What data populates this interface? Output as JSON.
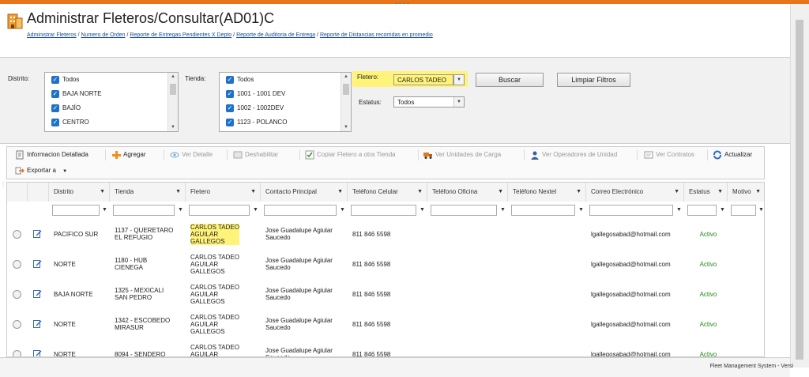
{
  "header": {
    "title": "Administrar Fleteros/Consultar(AD01)C",
    "breadcrumb": [
      {
        "label": "Administrar Fleteros"
      },
      {
        "label": "Numero de Orden"
      },
      {
        "label": "Reporte de Entregas Pendientes X Depto"
      },
      {
        "label": "Reporte de Auditoria de Entrega"
      },
      {
        "label": "Reporte de Distancias recorridas en promedio"
      }
    ],
    "separator": "/"
  },
  "filters": {
    "distrito_label": "Distrito:",
    "distrito_items": [
      "Todos",
      "BAJA NORTE",
      "BAJÍO",
      "CENTRO"
    ],
    "tienda_label": "Tienda:",
    "tienda_items": [
      "Todos",
      "1001 - 1001 DEV",
      "1002 - 1002DEV",
      "1123 - POLANCO"
    ],
    "fletero_label": "Fletero:",
    "fletero_value": "CARLOS TADEO",
    "estatus_label": "Estatus:",
    "estatus_value": "Todos",
    "buscar_label": "Buscar",
    "limpiar_label": "Limpiar Filtros"
  },
  "toolbar": {
    "info": "Informacion Detallada",
    "agregar": "Agregar",
    "ver_detalle": "Ver Detalle",
    "deshabilitar": "Deshabilitar",
    "copiar": "Copiar Fletero a otra Tienda",
    "ver_unidades": "Ver Unidades de Carga",
    "ver_operadores": "Ver Operadores de Unidad",
    "ver_contratos": "Ver Contratos",
    "actualizar": "Actualizar",
    "exportar": "Exportar a"
  },
  "grid": {
    "columns": [
      "Distrito",
      "Tienda",
      "Fletero",
      "Contacto Principal",
      "Teléfono Celular",
      "Teléfono Oficina",
      "Teléfono Nextel",
      "Correo Electrónico",
      "Estatus",
      "Motivo"
    ],
    "rows": [
      {
        "distrito": "PACIFICO SUR",
        "tienda": "1137 - QUERETARO\nEL REFUGIO",
        "fletero": "CARLOS TADEO\nAGUILAR\nGALLEGOS",
        "contacto": "Jose Guadalupe Agiular\nSaucedo",
        "celular": "811 846 5598",
        "oficina": "",
        "nextel": "",
        "correo": "lgallegosabad@hotmail.com",
        "estatus": "Activo",
        "motivo": ""
      },
      {
        "distrito": "NORTE",
        "tienda": "1180 - HUB\nCIENEGA",
        "fletero": "CARLOS TADEO\nAGUILAR\nGALLEGOS",
        "contacto": "Jose Guadalupe Agiular\nSaucedo",
        "celular": "811 846 5598",
        "oficina": "",
        "nextel": "",
        "correo": "lgallegosabad@hotmail.com",
        "estatus": "Activo",
        "motivo": ""
      },
      {
        "distrito": "BAJA NORTE",
        "tienda": "1325 - MEXICALI\nSAN PEDRO",
        "fletero": "CARLOS TADEO\nAGUILAR\nGALLEGOS",
        "contacto": "Jose Guadalupe Agiular\nSaucedo",
        "celular": "811 846 5598",
        "oficina": "",
        "nextel": "",
        "correo": "lgallegosabad@hotmail.com",
        "estatus": "Activo",
        "motivo": ""
      },
      {
        "distrito": "NORTE",
        "tienda": "1342 - ESCOBEDO\nMIRASUR",
        "fletero": "CARLOS TADEO\nAGUILAR\nGALLEGOS",
        "contacto": "Jose Guadalupe Agiular\nSaucedo",
        "celular": "811 846 5598",
        "oficina": "",
        "nextel": "",
        "correo": "lgallegosabad@hotmail.com",
        "estatus": "Activo",
        "motivo": ""
      },
      {
        "distrito": "NORTE",
        "tienda": "8094 - SENDERO",
        "fletero": "CARLOS TADEO\nAGUILAR\nGALLEGOS",
        "contacto": "Jose Guadalupe Agiular\nSaucedo",
        "celular": "811 846 5598",
        "oficina": "",
        "nextel": "",
        "correo": "lgallegosabad@hotmail.com",
        "estatus": "Activo",
        "motivo": ""
      }
    ]
  },
  "footer": "Fleet Management System - Versi",
  "colors": {
    "accent": "#e8751a",
    "highlight": "#fff37a",
    "link": "#1a4aa0",
    "status_active": "#1f8a1f",
    "checkbox": "#1e73c9"
  }
}
